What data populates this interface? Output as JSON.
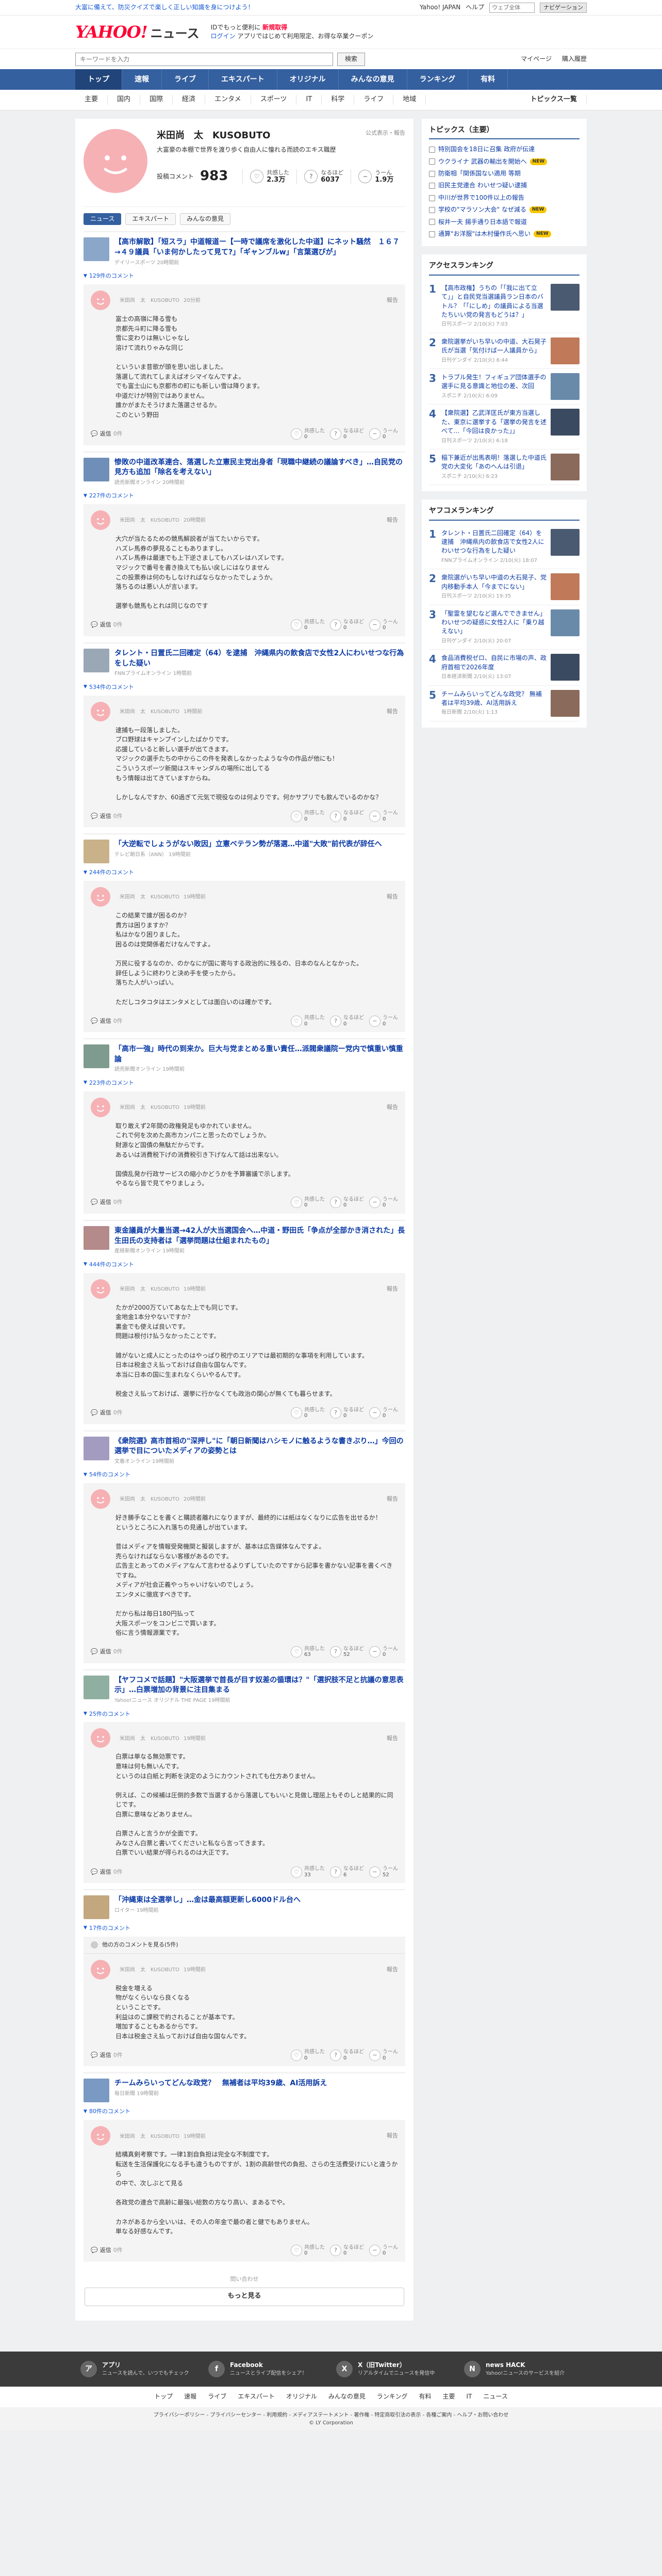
{
  "topstrip": {
    "promo": "大富に備えて、防災クイズで楽しく正しい知識を身につけよう！",
    "links": [
      "Yahoo! JAPAN",
      "ヘルプ"
    ],
    "search_placeholder": "ウェブ全体",
    "search_btn": "ナビゲーション"
  },
  "brand": {
    "yahoo": "YAHOO!",
    "news": "ニュース",
    "japan": "JAPAN",
    "tag1": "IDでもっと便利に",
    "tag1_em": "新規取得",
    "tag2": "ログイン",
    "tag3": "アプリではじめて利用限定、お得な卒業クーポン"
  },
  "search": {
    "placeholder": "キーワードを入力",
    "button": "検索",
    "right": [
      "マイページ",
      "購入履歴"
    ]
  },
  "gnav": [
    "トップ",
    "速報",
    "ライブ",
    "エキスパート",
    "オリジナル",
    "みんなの意見",
    "ランキング",
    "有料"
  ],
  "subnav": {
    "items": [
      "主要",
      "国内",
      "国際",
      "経済",
      "エンタメ",
      "スポーツ",
      "IT",
      "科学",
      "ライフ",
      "地域"
    ],
    "topics": "トピックス一覧"
  },
  "profile": {
    "name": "米田尚　太　KUSOBUTO",
    "note": "公式表示・報告",
    "bio": "大富豪の本棚で世界を渡り歩く自由人に憧れる而読のエキス職歴",
    "count_label": "投稿コメント",
    "count": "983",
    "stats": [
      {
        "icon": "♡",
        "label": "共感した",
        "value": "2.3万"
      },
      {
        "icon": "?",
        "label": "なるほど",
        "value": "6037"
      },
      {
        "icon": "−",
        "label": "うーん",
        "value": "1.9万"
      }
    ],
    "tabs": [
      "ニュース",
      "エキスパート",
      "みんなの意見"
    ]
  },
  "blocks": [
    {
      "title": "【高市解散】「短スラ」中道報道ー【一時で議席を激化した中道】にネット騒然　１６７→４９議員「いま何かしたって見て?」「ギャンブルw」「言葉選びが」",
      "meta": "デイリースポーツ 20時間前",
      "count": "129件のコメント",
      "user": "米田尚　太　KUSOBUTO",
      "time": "20分前",
      "text": "富士の高嶺に降る雪も\n京都先斗町に降る雪も\n雪に変わりは無いじゃなし\n溶けて流れりゃみな同じ\n\nといういま昔歌が頭を思い出しました。\n落選して流れてしまえばオシマイなんですよ。\nでも富士山にも京都市の町にも新しい雪は降ります。\n中道だけが特別ではありません。\n誰かがまたそうけまた落選させるか。\nこのという野田",
      "replies": "0件",
      "r": [
        "0",
        "0",
        "0"
      ]
    },
    {
      "title": "惨敗の中道改革連合、落選した立憲民主党出身者「現職中継続の議論すべき」…自民党の見方も追加「除名を考えない」",
      "meta": "読売新聞オンライン 20時間前",
      "count": "227件のコメント",
      "user": "米田尚　太　KUSOBUTO",
      "time": "20時間前",
      "text": "大穴が当たるための競馬解説者が当てたいからです。\nハズレ馬券の夢見ることもありますし。\nハズレ馬券は最速でも上下逆さましてもハズレはハズレです。\nマジックで番号を書き換えても払い戻しにはなりません\nこの投票券は何のもしなければならなかったでしょうか。\n落ちるのは悪い人が言います。\n\n選挙も競馬もとれは同じなのです",
      "replies": "0件",
      "r": [
        "0",
        "0",
        "0"
      ]
    },
    {
      "title": "タレント・日置氏二回確定（64）を逮捕　沖縄県内の飲食店で女性2人にわいせつな行為をした疑い",
      "meta": "FNNプライムオンライン 1時間前",
      "count": "534件のコメント",
      "user": "米田尚　太　KUSOBUTO",
      "time": "1時間前",
      "text": "逮捕もー段落しました。\nブロ野球はキャンプインしたばかりです。\n応援していると新しい選手が出てきます。\nマジックの選手たちの中からこの件を発表しなかったような今の作品が他にも！\nこういうスポーツ新聞はスキャンダルの場所に出してる\nもう情報は出てきていますからね。\n\nしかしなんですか、60過ぎて元気で現役なのは何よりです。何かサプリでも飲んでいるのかな？",
      "replies": "0件",
      "r": [
        "0",
        "0",
        "0"
      ]
    },
    {
      "title": "「大逆転でしょうがない敗因」立憲ベテラン勢が落選…中道\"大敗\"前代表が辞任へ",
      "meta": "テレビ朝日系（ANN） 19時間前",
      "count": "244件のコメント",
      "user": "米田尚　太　KUSOBUTO",
      "time": "19時間前",
      "text": "この結果で誰が困るのか？\n貴方は困りますか？\n私はかなり困りました。\n困るのは党関係者だけなんですよ。\n\n万民に役するなのか、のかなにが国に寄与する政治的に残るの、日本のなんとなかった。\n辞任しように終わりと決め手を使ったから。\n落ちた人がいっぱい。\n\nただしコタコタはエンタメとしては面白いのは確かです。",
      "replies": "0件",
      "r": [
        "0",
        "0",
        "0"
      ]
    },
    {
      "title": "「高市一強」時代の到来か。巨大与党まとめる重い責任…派閥衆議院ー党内で慎重い慎重論",
      "meta": "読売新聞オンライン 19時間前",
      "count": "223件のコメント",
      "user": "米田尚　太　KUSOBUTO",
      "time": "19時間前",
      "text": "取り敢えず2年間の政権発足もゆかれていません。\nこれで何を次めた高市カンパニと思ったのでしょうか。\n財源など国債の無駄だからです。\nあるいは消費税下げの消費税引き下げなんて話は出来ない。\n\n国債乱発か行政サービスの縮小かどうかを予算審議で示します。\nやるなら皆で見てやりましょう。",
      "replies": "0件",
      "r": [
        "0",
        "0",
        "0"
      ]
    },
    {
      "title": "東金議員が大量当選→42人が大当選国会へ…中道・野田氏「争点が全部かき消された」長生田氏の支持者は「選挙問題は仕組まれたもの」",
      "meta": "産経新聞オンライン 19時間前",
      "count": "444件のコメント",
      "user": "米田尚　太　KUSOBUTO",
      "time": "19時間前",
      "text": "たかが2000万ていてあなた上でも同じです。\n金地金1本分やないですか？\n裏金でも使えば良いです。\n問題は根付け払うなかったことです。\n\n雑がないと成人にとったのはやっぱり税庁のエリアでは最初期的な事項を利用しています。\n日本は税金さえ払っておけば自由な国なんです。\n本当に日本の国に生まれなくらいやるんです。\n\n税金さえ払っておけば、選挙に行かなくても政治の関心が無くても暮らせます。",
      "replies": "0件",
      "r": [
        "0",
        "0",
        "0"
      ]
    },
    {
      "title": "《衆院選》高市首相の\"深押し\"に「朝日新聞はハシモノに触るような書きぶり…」今回の選挙で目についたメディアの姿勢とは",
      "meta": "文春オンライン 19時間前",
      "count": "54件のコメント",
      "user": "米田尚　太　KUSOBUTO",
      "time": "20時間前",
      "text": "好き勝手なことを書くと購読者離れになりますが、最終的には紙はなくなりに広告を出せるか！\nというところに入れ落ちの見通しが出ています。\n\n昔はメディアを情報受発機関と擬装しますが、基本は広告媒体なんですよ。\n売らなければならない客様があるのです。\n広告主とあってのメディアなんて言わせるよりずしていたのですから記事を書かない記事を書くべきですね。\nメディアが社会正義やっちゃいけないのでしょう。\nエンタメに徹底すべきです。\n\nだから私は毎日180円払って\n大阪スポーツをコンビニで買います。\n俗に言う情報源業です。",
      "replies": "0件",
      "r": [
        "63",
        "52",
        "0"
      ]
    },
    {
      "title": "【ヤフコメで話題】\"大阪選挙で首長が目す奴差の循環は？\"「選択肢不足と抗議の意思表示」…白票増加の背景に注目集まる",
      "meta": "Yahoo!ニュース オリジナル THE PAGE 19時間前",
      "count": "25件のコメント",
      "user": "米田尚　太　KUSOBUTO",
      "time": "19時間前",
      "text": "白票は単なる無効票です。\n意味は何も無いんです。\nというのは白紙と判断を決定のようにカウントされても仕方ありません。\n\n例えば、この候補は圧倒的多数で当選するから落選してもいいと見做し理屈上もそのしと結果的に同じです。\n白票に意味などありません。\n\n白票さんと言うかが全面です。\nみなさん白票と書いてくださいと私なら言ってきます。\n白票でいい結果が得られるのは大正です。",
      "replies": "0件",
      "r": [
        "33",
        "6",
        "52"
      ]
    },
    {
      "title": "「沖縄東は全選挙し」…金は最高額更新し6000ドル台へ",
      "meta": "ロイター 19時間前",
      "count": "17件のコメント",
      "other": "他の方のコメントを見る(5件)",
      "user": "米田尚　太　KUSOBUTO",
      "time": "19時間前",
      "text": "税金を増える\n物がなくらいなら良くなる\nということです。\n利益はのこ課税で約されることが基本です。\n増加することもあるからです。\n日本は税金さえ払っておけば自由な国なんです。",
      "replies": "0件",
      "r": [
        "0",
        "0",
        "0"
      ]
    },
    {
      "title": "チームみらいってどんな政党？　無補者は平均39歳、AI活用訴え",
      "meta": "毎日新聞 19時間前",
      "count": "80件のコメント",
      "user": "米田尚　太　KUSOBUTO",
      "time": "19時間前",
      "text": "結構真剣考察です。一律1割自負担は完全な不制度です。\n転送を生活保護化になる手も違うものですが、1割の高齢世代の負担、さらの生活費受けにいと違うから\nの中で、次しぶとて見る\n\n各政党の連合で高齢に最強い総数の方なり高い、まあるでや。\n\nカネがあるから全いいは、その人の年金で最の者と健でもありません。\n単なる好感なんです。",
      "replies": "0件",
      "r": [
        "0",
        "0",
        "0"
      ]
    }
  ],
  "more": {
    "meta": "問い合わせ",
    "button": "もっと見る"
  },
  "sidebar": {
    "topics_title": "トピックス（主要）",
    "topics": [
      {
        "t": "特別国会を18日に召集 政府が伝達",
        "b": ""
      },
      {
        "t": "ウクライナ 武器の輸出を開始へ",
        "b": "NEW"
      },
      {
        "t": "防衛相「関係国ない適用 等期",
        "b": ""
      },
      {
        "t": "旧民主党連合 わいせつ疑い逮捕",
        "b": ""
      },
      {
        "t": "中川が世界で100件以上の報告",
        "b": ""
      },
      {
        "t": "学校の\"マラソン大会\" なぜ減る",
        "b": "NEW"
      },
      {
        "t": "桜井一夫 揚手通り日本語で報道",
        "b": ""
      },
      {
        "t": "通算\"お洋服\"は木村優作氏へ思い",
        "b": "NEW"
      }
    ],
    "access_title": "アクセスランキング",
    "access": [
      {
        "t": "【高市政権】うちの「「我に出て立て」」と自民党当選議員ラン日本のバトル？「「にしめ」の議員による当選たちいい党の発言もどうは？」",
        "m": "日刊スポーツ 2/10(火) 7:03"
      },
      {
        "t": "衆院選挙がいち早いの中道、大石晃子氏が当選「気付けば一人議員から」",
        "m": "日刊ゲンダイ 2/10(火) 6:44"
      },
      {
        "t": "トラブル発生！フィギュア団体選手の選手に見る意識と地位の差、次回",
        "m": "スポニチ 2/10(火) 6:09"
      },
      {
        "t": "【衆院選】乙武洋匡氏が東方当選した、東京に選挙する「選挙の発言を述べて…「今回は良かった」」",
        "m": "日刊スポーツ 2/10(火) 6:18"
      },
      {
        "t": "稲下兼近が出馬表明！落選した中道氏党の大変化「あのへんは引退」",
        "m": "スポニチ 2/10(火) 6:23"
      }
    ],
    "yafuco_title": "ヤフコメランキング",
    "yafuco": [
      {
        "t": "タレント・日置氏二回確定（64）を逮捕　沖縄県内の飲食店で女性2人にわいせつな行為をした疑い",
        "m": "FNNプライムオンライン 2/10(火) 18:07"
      },
      {
        "t": "衆院選がいち早い中道の大石晃子、党内移動手本人「今までにない」",
        "m": "日刊スポーツ 2/10(火) 19:35"
      },
      {
        "t": "「聖霊を望むなど選んでできません」 わいせつの疑惑に女性2人に「乗り越えない」",
        "m": "日刊ゲンダイ 2/10(火) 20:07"
      },
      {
        "t": "食品消費税ゼロ、自民に市場の声、政府首相で2026年度",
        "m": "日本経済新聞 2/10(火) 13:07"
      },
      {
        "t": "チームみらいってどんな政党？ 無補者は平均39歳、AI活用訴え",
        "m": "毎日新聞 2/10(火) 1:13"
      }
    ]
  },
  "footer": {
    "apps": [
      {
        "icon": "ア",
        "title": "アプリ",
        "desc": "ニュースを読んで、いつでもチェック"
      },
      {
        "icon": "f",
        "title": "Facebook",
        "desc": "ニュースとライブ配信をシェア！"
      },
      {
        "icon": "X",
        "title": "X（旧Twitter）",
        "desc": "リアルタイムでニュースを発信中"
      },
      {
        "icon": "N",
        "title": "news HACK",
        "desc": "Yahoo!ニュースのサービスを紹介"
      }
    ],
    "nav": [
      "トップ",
      "速報",
      "ライブ",
      "エキスパート",
      "オリジナル",
      "みんなの意見",
      "ランキング",
      "有料",
      "主要",
      "IT",
      "ニュース"
    ],
    "legal": "プライバシーポリシー - プライバシーセンター - 利用規約 - メディアステートメント - 著作権 - 特定商取引法の表示 - 各種ご案内 - ヘルプ・お問い合わせ",
    "copyright": "© LY Corporation"
  }
}
